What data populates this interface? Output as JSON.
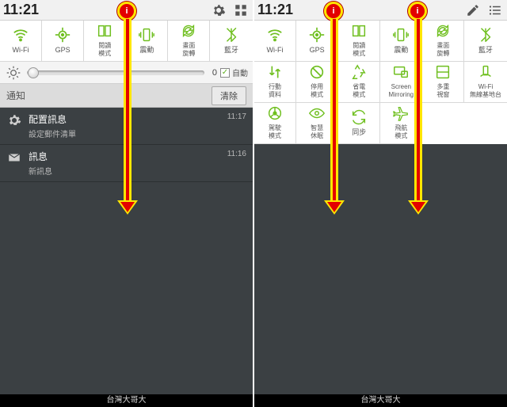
{
  "left": {
    "statusbar": {
      "clock": "11:21"
    },
    "quick": [
      {
        "label": "Wi-Fi",
        "icon": "wifi"
      },
      {
        "label": "GPS",
        "icon": "gps"
      },
      {
        "label": "閱讀\n模式",
        "icon": "book"
      },
      {
        "label": "震動",
        "icon": "vibrate"
      },
      {
        "label": "畫面\n旋轉",
        "icon": "rotate"
      },
      {
        "label": "藍牙",
        "icon": "bluetooth"
      }
    ],
    "brightness": {
      "value": "0",
      "auto_label": "自動"
    },
    "subhead": {
      "title": "通知",
      "clear": "清除"
    },
    "notifications": [
      {
        "icon": "gear",
        "title": "配置訊息",
        "subtitle": "設定郵件清單",
        "time": "11:17"
      },
      {
        "icon": "mail",
        "title": "訊息",
        "subtitle": "新訊息",
        "time": "11:16"
      }
    ],
    "carrier": "台灣大哥大"
  },
  "right": {
    "statusbar": {
      "clock": "11:21"
    },
    "quick": [
      {
        "label": "Wi-Fi",
        "icon": "wifi"
      },
      {
        "label": "GPS",
        "icon": "gps"
      },
      {
        "label": "閱讀\n模式",
        "icon": "book"
      },
      {
        "label": "震動",
        "icon": "vibrate"
      },
      {
        "label": "畫面\n旋轉",
        "icon": "rotate"
      },
      {
        "label": "藍牙",
        "icon": "bluetooth"
      },
      {
        "label": "行動\n資料",
        "icon": "data"
      },
      {
        "label": "停用\n模式",
        "icon": "block"
      },
      {
        "label": "省電\n模式",
        "icon": "recycle"
      },
      {
        "label": "Screen\nMirroring",
        "icon": "screen"
      },
      {
        "label": "多重\n視窗",
        "icon": "multi"
      },
      {
        "label": "Wi-Fi\n無線基地台",
        "icon": "hotspot"
      },
      {
        "label": "駕駛\n模式",
        "icon": "wheel"
      },
      {
        "label": "智慧\n休眠",
        "icon": "eye"
      },
      {
        "label": "同步",
        "icon": "sync"
      },
      {
        "label": "飛航\n模式",
        "icon": "plane"
      }
    ],
    "carrier": "台灣大哥大"
  },
  "arrow_label": "i"
}
